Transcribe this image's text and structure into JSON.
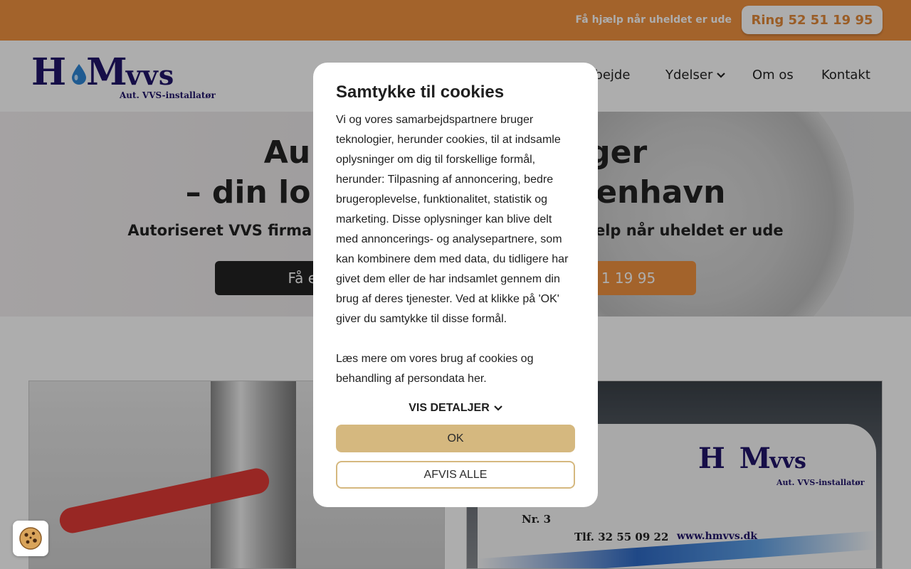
{
  "topbar": {
    "help_text": "Få hjælp når uheldet er ude",
    "call_button": "Ring 52 51 19 95"
  },
  "header": {
    "logo": {
      "word": "HMvvs",
      "subtitle": "Aut. VVS-installatør"
    },
    "nav": [
      {
        "label": "Tidligere arbejde",
        "visible_fragment": "rbejde"
      },
      {
        "label": "Ydelser"
      },
      {
        "label": "Om os"
      },
      {
        "label": "Kontakt"
      }
    ]
  },
  "hero": {
    "title_line1_left": "Au",
    "title_line1_right": "ger",
    "title_line2_left": "– din lok",
    "title_line2_right": "benhavn",
    "subtitle_left": "Autoriseret VVS firma",
    "subtitle_right": "ælp når uheldet er ude",
    "button_dark": "Få et ufor",
    "button_orange": "1 19 95"
  },
  "van": {
    "nr": "Nr. 3",
    "phone": "Tlf. 32 55 09 22",
    "website": "www.hmvvs.dk"
  },
  "cookie_modal": {
    "title": "Samtykke til cookies",
    "paragraph1": "Vi og vores samarbejdspartnere bruger teknologier, herunder cookies, til at indsamle oplysninger om dig til forskellige formål, herunder: Tilpasning af annoncering, bedre brugeroplevelse, funktionalitet, statistik og marketing. Disse oplysninger kan blive delt med annoncerings- og analysepartnere, som kan kombinere dem med data, du tidligere har givet dem eller de har indsamlet gennem din brug af deres tjenester. Ved at klikke på 'OK' giver du samtykke til disse formål.",
    "paragraph2": "Læs mere om vores brug af cookies og behandling af persondata her.",
    "details_label": "VIS DETALJER",
    "ok_label": "OK",
    "reject_label": "AFVIS ALLE"
  },
  "colors": {
    "brand_orange": "#f19240",
    "logo_navy": "#21156a",
    "consent_gold": "#d5b87f"
  },
  "icons": {
    "nav_dropdown": "chevron-down-icon",
    "details_toggle": "chevron-down-icon",
    "cookie_widget": "cookie-icon",
    "logo_drop": "water-drop-icon"
  }
}
